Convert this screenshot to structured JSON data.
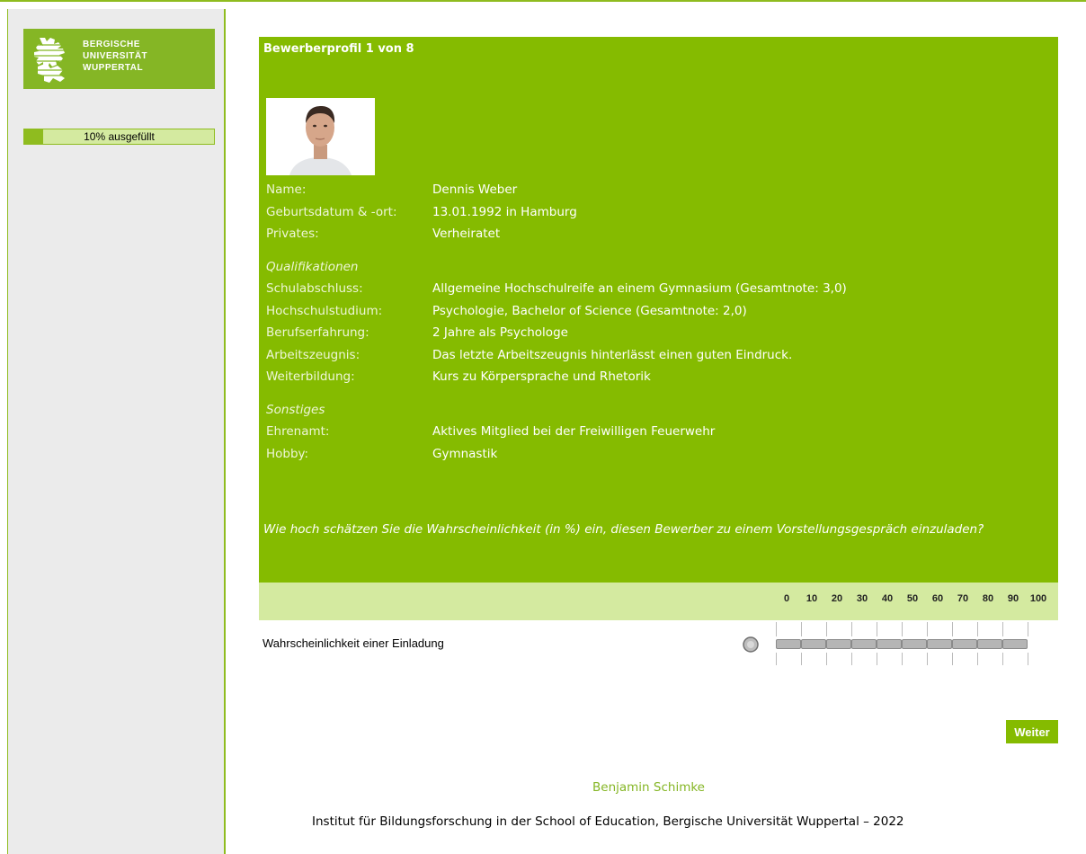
{
  "logo": {
    "line1": "BERGISCHE",
    "line2": "UNIVERSITÄT",
    "line3": "WUPPERTAL"
  },
  "progress": {
    "label": "10% ausgefüllt",
    "fraction": 0.1
  },
  "profile": {
    "title": "Bewerberprofil 1 von 8",
    "rows": [
      {
        "key": "Name:",
        "value": "Dennis Weber"
      },
      {
        "key": "Geburtsdatum & -ort:",
        "value": "13.01.1992 in Hamburg"
      },
      {
        "key": "Privates:",
        "value": "Verheiratet"
      }
    ],
    "section_qual": "Qualifikationen",
    "qual_rows": [
      {
        "key": "Schulabschluss:",
        "value": "Allgemeine Hochschulreife an einem Gymnasium (Gesamtnote: 3,0)"
      },
      {
        "key": "Hochschulstudium:",
        "value": "Psychologie, Bachelor of Science (Gesamtnote: 2,0)"
      },
      {
        "key": "Berufserfahrung:",
        "value": "2 Jahre als Psychologe"
      },
      {
        "key": "Arbeitszeugnis:",
        "value": "Das letzte Arbeitszeugnis hinterlässt einen guten Eindruck."
      },
      {
        "key": "Weiterbildung:",
        "value": "Kurs zu Körpersprache und Rhetorik"
      }
    ],
    "section_misc": "Sonstiges",
    "misc_rows": [
      {
        "key": "Ehrenamt:",
        "value": "Aktives Mitglied bei der Freiwilligen Feuerwehr"
      },
      {
        "key": "Hobby:",
        "value": "Gymnastik"
      }
    ],
    "question": "Wie hoch schätzen Sie die Wahrscheinlichkeit (in %) ein, diesen Bewerber zu einem Vorstellungsgespräch einzuladen?"
  },
  "scale": {
    "labels": [
      "0",
      "10",
      "20",
      "30",
      "40",
      "50",
      "60",
      "70",
      "80",
      "90",
      "100"
    ],
    "item_label": "Wahrscheinlichkeit einer Einladung"
  },
  "next_button": "Weiter",
  "footer": {
    "author": "Benjamin Schimke",
    "institute": "Institut für Bildungsforschung in der School of Education, Bergische Universität Wuppertal – 2022"
  },
  "colors": {
    "accent": "#85bb00",
    "accent_light": "#d4eaa0",
    "sidebar_bg": "#ebebeb"
  }
}
